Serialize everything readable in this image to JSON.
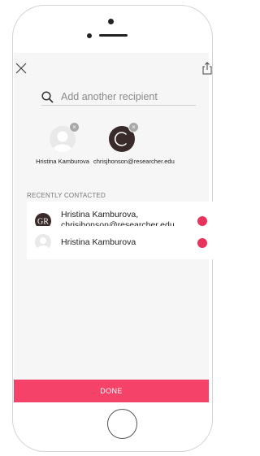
{
  "search": {
    "placeholder": "Add another recipient",
    "value": ""
  },
  "recipients": [
    {
      "name": "Hristina Kamburova",
      "avatar": "default-person-avatar"
    },
    {
      "name": "chrisjhonson@researcher.edu",
      "avatar": "letter-c-avatar"
    }
  ],
  "recent": {
    "label": "RECENTLY CONTACTED",
    "items": [
      {
        "line1": "Hristina Kamburova,",
        "line2": "chrisjhonson@researcher.edu",
        "avatar": "gr-group-avatar"
      },
      {
        "line1": "Hristina Kamburova",
        "avatar": "default-person-avatar"
      }
    ]
  },
  "done_label": "DONE",
  "icons": {
    "close": "close-icon",
    "share": "share-icon",
    "search": "search-icon",
    "remove": "remove-icon"
  },
  "colors": {
    "accent": "#f44268",
    "status_dot": "#e8335c"
  }
}
